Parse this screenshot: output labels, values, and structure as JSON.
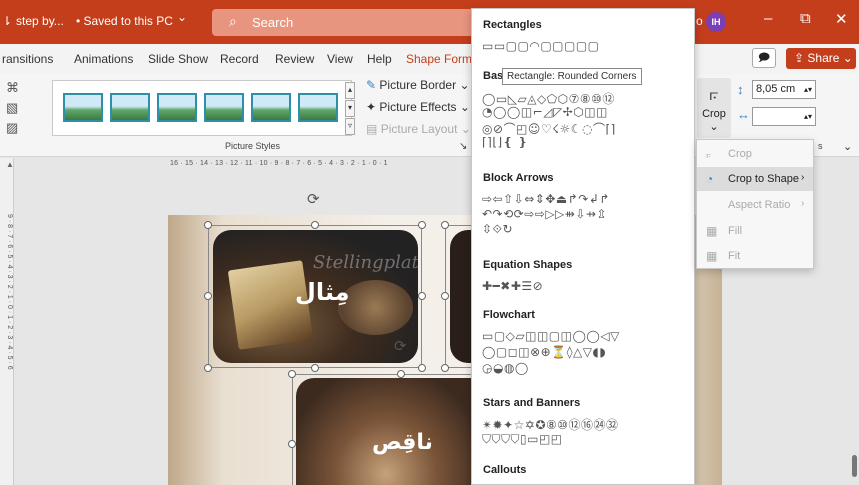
{
  "titlebar": {
    "filename": "step by...",
    "save_status": "• Saved to this PC",
    "save_chevron": "⌄",
    "search_icon": "⌕",
    "search_text": "Search",
    "user_initials": "IH",
    "user_letter": "o",
    "minimize": "–",
    "restore": "⧉",
    "close": "✕",
    "qat_icon": "⇂"
  },
  "tabs": {
    "items": [
      "ransitions",
      "Animations",
      "Slide Show",
      "Record",
      "Review",
      "View",
      "Help",
      "Shape Forma"
    ],
    "comment_icon": "🗩",
    "share_label": "Share",
    "share_icon": "⇪",
    "share_chevron": "⌄"
  },
  "ribbon": {
    "picture_border": "Picture Border",
    "picture_effects": "Picture Effects",
    "picture_layout": "Picture Layout",
    "chevron": "⌄",
    "styles_group_label": "Picture Styles",
    "crop_label": "Crop",
    "crop_chevron": "⌄",
    "height_value": "8,05 cm",
    "width_value": "",
    "launcher_icon": "↘",
    "collapse_icon": "⌄",
    "ribbon_fragment": "s"
  },
  "shapes_panel": {
    "sections": {
      "rectangles": "Rectangles",
      "basic": "Bas",
      "block_arrows": "Block Arrows",
      "equation": "Equation Shapes",
      "flowchart": "Flowchart",
      "stars": "Stars and Banners",
      "callouts": "Callouts"
    },
    "rows": {
      "rect": "▭▭▢▢◠▢▢▢▢▢",
      "basic1": "◯▭◺▱◬◇⬠⬡⑦⑧⑩⑫",
      "basic2": "◔◯◯◫⌐◿◸✢⬡◫◫",
      "basic3": "◎⊘⌒◰☺♡☇☼☾◌⌒⌈⌉",
      "basic4": "⌈⌉⌊⌋❴ ❵",
      "arrows1": "⇨⇦⇧⇩⇔⇕✥⏏↱↷↲↱",
      "arrows2": "↶↷⟲⟳⇨⇨▷▷⇻⇩⇸⇫",
      "arrows3": "⇳⟐↻",
      "eq": "✚━✖✚☰⊘",
      "flow1": "▭▢◇▱◫◫▢◫◯◯◁▽",
      "flow2": "◯▢◻◫⊗⊕⏳◊△▽◖◗",
      "flow3": "◶◒◍◯",
      "stars1": "✴✹✦☆✡✪⑧⑩⑫⑯㉔㉜",
      "stars2": "⛉⛉⛉⛉▯▭◰◰",
      "callouts": "◻◻◻◻◻◻◻◻◻◻"
    },
    "tooltip": "Rectangle: Rounded Corners"
  },
  "crop_menu": {
    "items": [
      {
        "label": "Crop",
        "icon": "⟔",
        "arrow": ""
      },
      {
        "label": "Crop to Shape",
        "icon": "◔",
        "arrow": "›"
      },
      {
        "label": "Aspect Ratio",
        "icon": "",
        "arrow": "›"
      },
      {
        "label": "Fill",
        "icon": "▦",
        "arrow": ""
      },
      {
        "label": "Fit",
        "icon": "▦",
        "arrow": ""
      }
    ]
  },
  "slide": {
    "word1": "مِثال",
    "word2": "ناقِص",
    "script_text": "Stellingplatz",
    "ruler_h": "16 · 15 · 14 · 13 · 12 · 11 · 10 · 9 · 8 · 7 · 6 · 5 · 4 · 3 · 2 · 1 · 0 · 1",
    "ruler_v": "9 · 8 · 7 · 6 · 5 · 4 · 3 · 2 · 1 · 0 · 1 · 2 · 3 · 4 · 5 · 6"
  }
}
